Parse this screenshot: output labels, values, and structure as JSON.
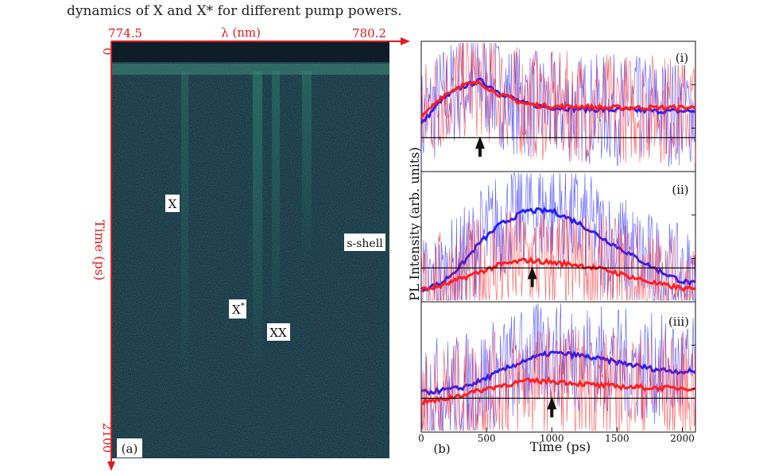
{
  "caption": "dynamics of X and X* for different pump powers.",
  "panel_a": {
    "label": "(a)",
    "top_axis": {
      "label": "λ (nm)",
      "left_tick": "774.5",
      "right_tick": "780.2"
    },
    "left_axis": {
      "label": "Time (ps)",
      "top_tick": "0",
      "bottom_tick": "2100"
    },
    "annotations": {
      "x": "X",
      "x_star": "X",
      "x_star_sup": "*",
      "xx": "XX",
      "s_shell": "s-shell"
    },
    "colors": {
      "axis": "#e41a1c",
      "background": "#0f2230",
      "streak": "#2e7a6a"
    }
  },
  "panel_b": {
    "label": "(b)",
    "ylabel": "PL Intensity (arb. units)",
    "xlabel": "Time (ps)",
    "x_ticks": [
      "0",
      "500",
      "1000",
      "1500",
      "2000"
    ],
    "subpanels": [
      {
        "label": "(i)",
        "arrow_time": 450
      },
      {
        "label": "(ii)",
        "arrow_time": 850
      },
      {
        "label": "(iii)",
        "arrow_time": 1000
      }
    ],
    "colors": {
      "blue_series": "#1f1fff",
      "red_series": "#ff1f1f"
    }
  },
  "chart_data": [
    {
      "type": "line",
      "panel": "(i)",
      "xlim": [
        0,
        2100
      ],
      "x": [
        0,
        150,
        300,
        450,
        600,
        800,
        1000,
        1200,
        1400,
        1600,
        1800,
        2000,
        2100
      ],
      "series": [
        {
          "values": [
            0.35,
            0.55,
            0.66,
            0.72,
            0.62,
            0.52,
            0.49,
            0.48,
            0.47,
            0.47,
            0.46,
            0.46,
            0.46
          ]
        },
        {
          "values": [
            0.4,
            0.58,
            0.68,
            0.7,
            0.6,
            0.52,
            0.5,
            0.5,
            0.49,
            0.49,
            0.49,
            0.49,
            0.49
          ]
        }
      ]
    },
    {
      "type": "line",
      "panel": "(ii)",
      "xlim": [
        0,
        2100
      ],
      "x": [
        0,
        150,
        300,
        450,
        600,
        800,
        1000,
        1200,
        1400,
        1600,
        1800,
        2000,
        2100
      ],
      "series": [
        {
          "values": [
            0.05,
            0.1,
            0.25,
            0.45,
            0.6,
            0.72,
            0.72,
            0.62,
            0.48,
            0.35,
            0.22,
            0.12,
            0.1
          ]
        },
        {
          "values": [
            0.05,
            0.08,
            0.14,
            0.2,
            0.26,
            0.3,
            0.28,
            0.26,
            0.22,
            0.16,
            0.1,
            0.06,
            0.05
          ]
        }
      ]
    },
    {
      "type": "line",
      "panel": "(iii)",
      "xlim": [
        0,
        2100
      ],
      "x": [
        0,
        150,
        300,
        450,
        600,
        800,
        1000,
        1200,
        1400,
        1600,
        1800,
        2000,
        2100
      ],
      "series": [
        {
          "values": [
            0.28,
            0.3,
            0.32,
            0.38,
            0.46,
            0.56,
            0.62,
            0.6,
            0.56,
            0.52,
            0.48,
            0.46,
            0.46
          ]
        },
        {
          "values": [
            0.2,
            0.22,
            0.26,
            0.3,
            0.34,
            0.38,
            0.38,
            0.36,
            0.34,
            0.33,
            0.32,
            0.32,
            0.32
          ]
        }
      ]
    }
  ]
}
